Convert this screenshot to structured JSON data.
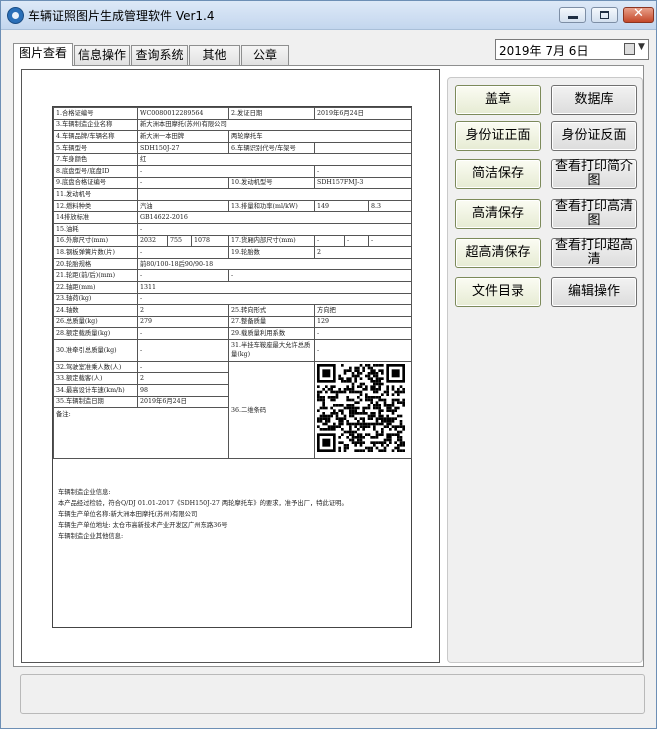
{
  "window": {
    "title": "车辆证照图片生成管理软件 Ver1.4",
    "close_glyph": "✕"
  },
  "tabs": [
    {
      "label": "图片查看",
      "active": true
    },
    {
      "label": "信息操作",
      "active": false
    },
    {
      "label": "查询系统",
      "active": false
    },
    {
      "label": "其他",
      "active": false
    },
    {
      "label": "公章",
      "active": false
    }
  ],
  "date_picker": {
    "value": "2019年  7月  6日"
  },
  "buttons": [
    {
      "label": "盖章"
    },
    {
      "label": "数据库"
    },
    {
      "label": "身份证正面"
    },
    {
      "label": "身份证反面"
    },
    {
      "label": "简洁保存"
    },
    {
      "label": "查看打印简介图"
    },
    {
      "label": "高清保存"
    },
    {
      "label": "查看打印高清图"
    },
    {
      "label": "超高清保存"
    },
    {
      "label": "查看打印超高清"
    },
    {
      "label": "文件目录"
    },
    {
      "label": "编辑操作"
    }
  ],
  "certificate": {
    "r1": {
      "l1": "1.合格证编号",
      "v1": "WC0080012289564",
      "l2": "2.发证日期",
      "v2": "2019年6月24日"
    },
    "r3": {
      "l": "3.车辆制造企业名称",
      "v": "新大洲本田摩托(苏州)有限公司"
    },
    "r4": {
      "l": "4.车辆品牌/车辆名称",
      "v1": "新大洲一本田牌",
      "v2": "两轮摩托车"
    },
    "r5": {
      "l1": "5.车辆型号",
      "v1": "SDH150J-27",
      "l2": "6.车辆识别代号/车架号",
      "v2": ""
    },
    "r7": {
      "l": "7.车身颜色",
      "v": "红"
    },
    "r8": {
      "l": "8.底盘型号/底盘ID",
      "v1": "-",
      "v2": "-"
    },
    "r9": {
      "l1": "9.底盘合格证编号",
      "v1": "-",
      "l2": "10.发动机型号",
      "v2": "SDH157FMJ-3"
    },
    "r11": {
      "l": "11.发动机号",
      "v": ""
    },
    "r12": {
      "l1": "12.燃料种类",
      "v1": "汽油",
      "l2": "13.排量和功率(ml/kW)",
      "v2a": "149",
      "v2b": "8.3"
    },
    "r14": {
      "l": "14排放标准",
      "v": "GB14622-2016"
    },
    "r15": {
      "l": "15.油耗",
      "v": "-"
    },
    "r16": {
      "l1": "16.外廓尺寸(mm)",
      "a": "2032",
      "b": "755",
      "c": "1078",
      "l2": "17.货厢内部尺寸(mm)",
      "d": "-",
      "e": "-",
      "f": "-"
    },
    "r18": {
      "l1": "18.钢板弹簧片数(片)",
      "v1": "-",
      "l2": "19.轮胎数",
      "v2": "2"
    },
    "r20": {
      "l": "20.轮胎规格",
      "v": "前80/100-18后90/90-18"
    },
    "r21": {
      "l": "21.轮距(前/后)(mm)",
      "v1": "-",
      "v2": "-"
    },
    "r22": {
      "l": "22.轴距(mm)",
      "v": "1311"
    },
    "r23": {
      "l": "23.轴荷(kg)",
      "v": "-"
    },
    "r24": {
      "l1": "24.轴数",
      "v1": "2",
      "l2": "25.转向形式",
      "v2": "方向把"
    },
    "r26": {
      "l1": "26.总质量(kg)",
      "v1": "279",
      "l2": "27.整备质量",
      "v2": "129"
    },
    "r28": {
      "l1": "28.额定载质量(kg)",
      "v1": "-",
      "l2": "29.载质量利用系数",
      "v2": "-"
    },
    "r30": {
      "l1": "30.准牵引总质量(kg)",
      "v1": "-",
      "l2": "31.半挂车鞍座最大允许总质量(kg)",
      "v2": "-"
    },
    "r32": {
      "l": "32.驾驶室准乘人数(人)",
      "v": "-"
    },
    "r33": {
      "l": "33.额定载客(人)",
      "v": "2"
    },
    "r34": {
      "l": "34.最高设计车速(km/h)",
      "v": "98"
    },
    "r35": {
      "l": "35.车辆制造日期",
      "v": "2019年6月24日"
    },
    "r36": {
      "l": "36.二维条码"
    },
    "remarks_label": "备注:",
    "footer": [
      "车辆制造企业信息:",
      "本产品经过检验，符合Q/DJ 01.01-2017《SDH150J-27 两轮摩托车》的要求，准予出厂，特此证明。",
      "车辆生产单位名称:新大洲本田摩托(苏州)有限公司",
      "车辆生产单位地址: 太仓市高新技术产业开发区广州东路36号",
      "车辆制造企业其他信息:"
    ]
  }
}
